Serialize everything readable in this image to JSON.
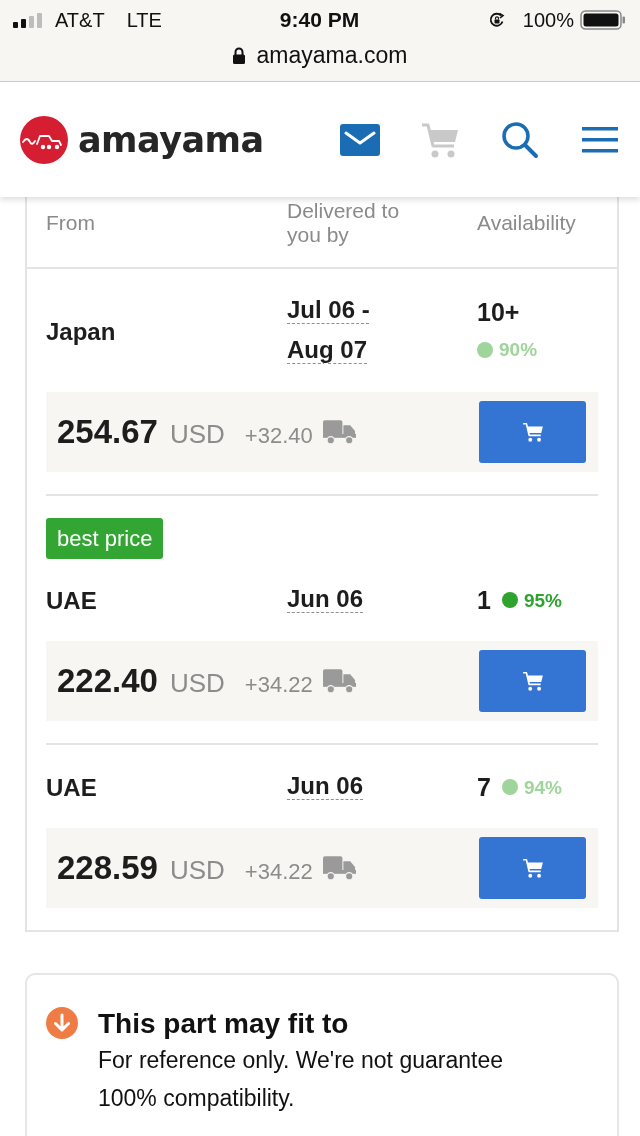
{
  "status_bar": {
    "carrier": "AT&T",
    "network": "LTE",
    "time": "9:40 PM",
    "battery": "100%"
  },
  "address_bar": {
    "url": "amayama.com"
  },
  "header": {
    "logo": "amayama"
  },
  "offers_table": {
    "columns": [
      "From",
      "Delivered to you by",
      "Availability"
    ],
    "offers": [
      {
        "origin": "Japan",
        "delivery": "Jul 06 - Aug 07",
        "stock": "10+",
        "reliability": "90%",
        "color": "#9fd59b",
        "price": "254.67",
        "currency": "USD",
        "shipping": "+32.40"
      },
      {
        "badge": "best price",
        "origin": "UAE",
        "delivery": "Jun 06",
        "stock": "1",
        "reliability": "95%",
        "color": "#2ea42e",
        "price": "222.40",
        "currency": "USD",
        "shipping": "+34.22"
      },
      {
        "origin": "UAE",
        "delivery": "Jun 06",
        "stock": "7",
        "reliability": "94%",
        "color": "#9fd59b",
        "price": "228.59",
        "currency": "USD",
        "shipping": "+34.22"
      }
    ]
  },
  "notice": {
    "title": "This part may fit to",
    "text": "For reference only. We're not guarantee 100% compatibility."
  }
}
